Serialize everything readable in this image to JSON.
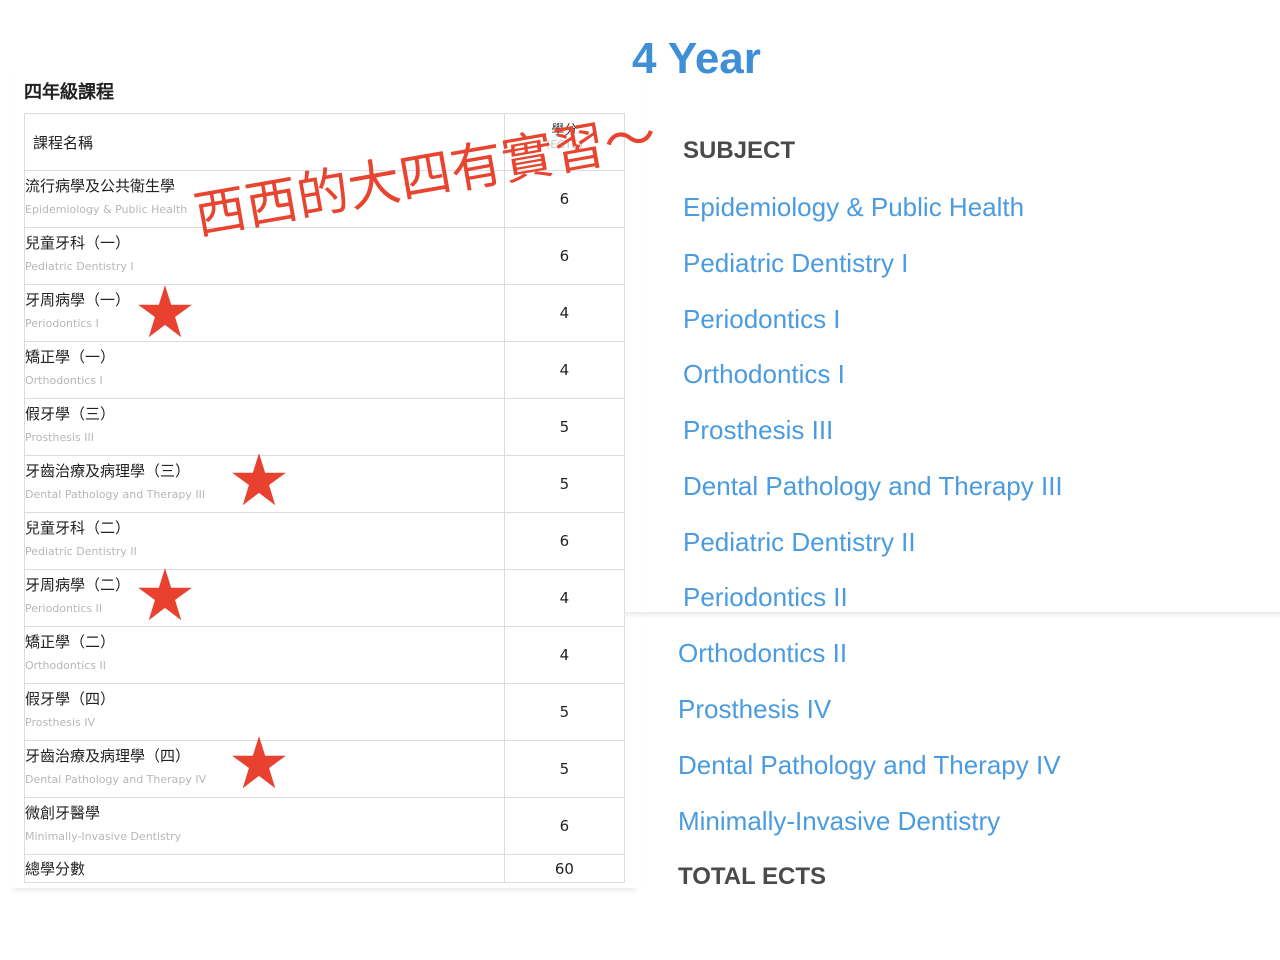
{
  "left": {
    "title": "四年級課程",
    "header": {
      "name": "課程名稱",
      "credit_zh": "學分",
      "credit_en": "(ECTS)"
    },
    "courses": [
      {
        "zh": "流行病學及公共衛生學",
        "en": "Epidemiology & Public Health",
        "credits": "6"
      },
      {
        "zh": "兒童牙科（一）",
        "en": "Pediatric Dentistry I",
        "credits": "6"
      },
      {
        "zh": "牙周病學（一）",
        "en": "Periodontics I",
        "credits": "4"
      },
      {
        "zh": "矯正學（一）",
        "en": "Orthodontics I",
        "credits": "4"
      },
      {
        "zh": "假牙學（三）",
        "en": "Prosthesis III",
        "credits": "5"
      },
      {
        "zh": "牙齒治療及病理學（三）",
        "en": "Dental Pathology and Therapy III",
        "credits": "5"
      },
      {
        "zh": "兒童牙科（二）",
        "en": "Pediatric Dentistry II",
        "credits": "6"
      },
      {
        "zh": "牙周病學（二）",
        "en": "Periodontics II",
        "credits": "4"
      },
      {
        "zh": "矯正學（二）",
        "en": "Orthodontics II",
        "credits": "4"
      },
      {
        "zh": "假牙學（四）",
        "en": "Prosthesis IV",
        "credits": "5"
      },
      {
        "zh": "牙齒治療及病理學（四）",
        "en": "Dental Pathology and Therapy IV",
        "credits": "5"
      },
      {
        "zh": "微創牙醫學",
        "en": "Minimally-Invasive Dentistry",
        "credits": "6"
      }
    ],
    "total": {
      "label": "總學分數",
      "value": "60"
    }
  },
  "overlay": {
    "handwriting": "西西的大四有實習～",
    "color": "#e8442f",
    "star_color": "#e8412f"
  },
  "right": {
    "title": "4 Year",
    "subject_heading": "SUBJECT",
    "subjects": [
      "Epidemiology & Public Health",
      "Pediatric Dentistry I",
      "Periodontics I",
      "Orthodontics I",
      "Prosthesis III",
      "Dental Pathology and Therapy III",
      "Pediatric Dentistry II",
      "Periodontics II",
      "Orthodontics II",
      "Prosthesis IV",
      "Dental Pathology and Therapy IV",
      "Minimally-Invasive Dentistry"
    ],
    "total_heading": "TOTAL ECTS",
    "title_color": "#3f8fd6",
    "subject_color": "#4a9be0"
  }
}
